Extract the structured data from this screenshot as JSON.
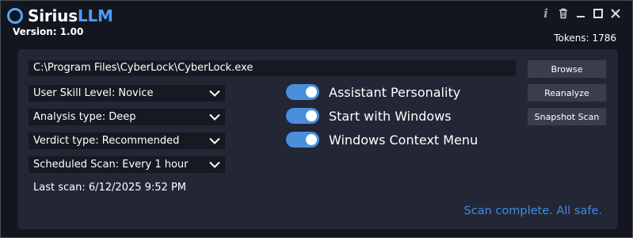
{
  "app": {
    "name_part1": "Sirius",
    "name_part2": "LLM",
    "version": "Version: 1.00",
    "tokens": "Tokens: 1786",
    "title_icons": [
      "info-icon",
      "trash-icon",
      "minimize-icon",
      "maximize-icon",
      "close-icon"
    ],
    "info_glyph": "i"
  },
  "file": {
    "path": "C:\\Program Files\\CyberLock\\CyberLock.exe"
  },
  "buttons": {
    "browse": "Browse",
    "reanalyze": "Reanalyze",
    "snapshot": "Snapshot Scan"
  },
  "dropdowns": [
    {
      "label": "User Skill Level: Novice"
    },
    {
      "label": "Analysis type: Deep"
    },
    {
      "label": "Verdict type: Recommended"
    },
    {
      "label": "Scheduled Scan: Every 1 hour"
    }
  ],
  "last_scan": "Last scan: 6/12/2025 9:52 PM",
  "toggles": [
    {
      "label": "Assistant Personality",
      "on": true
    },
    {
      "label": "Start with Windows",
      "on": true
    },
    {
      "label": "Windows Context Menu",
      "on": true
    }
  ],
  "status": "Scan complete. All safe.",
  "colors": {
    "background": "#13161f",
    "panel": "#232634",
    "accent": "#4a8fdc",
    "status": "#3f8ce8"
  }
}
